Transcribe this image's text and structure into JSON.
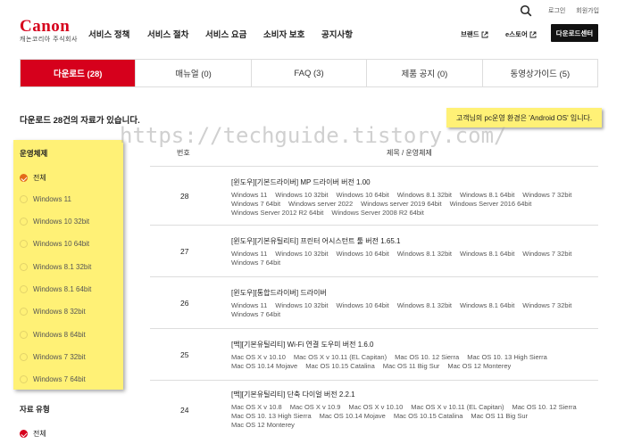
{
  "header": {
    "logo": "Canon",
    "logo_sub": "캐논코리아 주식회사",
    "nav": [
      "서비스 정책",
      "서비스 절차",
      "서비스 요금",
      "소비자 보호",
      "공지사항"
    ],
    "top_links": [
      "로그인",
      "회원가입"
    ],
    "brand_links": [
      "브랜드",
      "e스토어"
    ],
    "center_button": "다운로드센터"
  },
  "tabs": [
    {
      "label": "다운로드 (28)",
      "active": true
    },
    {
      "label": "매뉴얼 (0)",
      "active": false
    },
    {
      "label": "FAQ (3)",
      "active": false
    },
    {
      "label": "제품 공지 (0)",
      "active": false
    },
    {
      "label": "동영상가이드 (5)",
      "active": false
    }
  ],
  "result": {
    "prefix": "다운로드 ",
    "count": "28",
    "suffix": "건의 자료가 있습니다.",
    "os_notice": "고객님의 pc운영 환경은 'Android OS' 입니다."
  },
  "watermark": "https://techguide.tistory.com/",
  "filters": {
    "os_title": "운영체제",
    "os_items": [
      {
        "label": "전체",
        "checked": true
      },
      {
        "label": "Windows 11",
        "checked": false
      },
      {
        "label": "Windows 10 32bit",
        "checked": false
      },
      {
        "label": "Windows 10 64bit",
        "checked": false
      },
      {
        "label": "Windows 8.1 32bit",
        "checked": false
      },
      {
        "label": "Windows 8.1 64bit",
        "checked": false
      },
      {
        "label": "Windows 8 32bit",
        "checked": false
      },
      {
        "label": "Windows 8 64bit",
        "checked": false
      },
      {
        "label": "Windows 7 32bit",
        "checked": false
      },
      {
        "label": "Windows 7 64bit",
        "checked": false
      }
    ],
    "type_title": "자료 유형",
    "type_items": [
      {
        "label": "전체",
        "checked": true
      }
    ]
  },
  "table": {
    "headers": [
      "번호",
      "제목 / 운영체제"
    ],
    "rows": [
      {
        "num": "28",
        "title": "[윈도우][기본드라이버] MP 드라이버 버전 1.00",
        "os": [
          "Windows 11",
          "Windows 10 32bit",
          "Windows 10 64bit",
          "Windows 8.1 32bit",
          "Windows 8.1 64bit",
          "Windows 7 32bit",
          "Windows 7 64bit",
          "Windows server 2022",
          "Windows server 2019 64bit",
          "Windows Server 2016 64bit",
          "Windows Server 2012 R2 64bit",
          "Windows Server 2008 R2 64bit"
        ]
      },
      {
        "num": "27",
        "title": "[윈도우][기본유틸리티] 프린터 어시스턴트 툴 버전 1.65.1",
        "os": [
          "Windows 11",
          "Windows 10 32bit",
          "Windows 10 64bit",
          "Windows 8.1 32bit",
          "Windows 8.1 64bit",
          "Windows 7 32bit",
          "Windows 7 64bit"
        ]
      },
      {
        "num": "26",
        "title": "[윈도우][통합드라이버] 드라이버",
        "os": [
          "Windows 11",
          "Windows 10 32bit",
          "Windows 10 64bit",
          "Windows 8.1 32bit",
          "Windows 8.1 64bit",
          "Windows 7 32bit",
          "Windows 7 64bit"
        ]
      },
      {
        "num": "25",
        "title": "[맥][기본유틸리티] Wi-Fi 연결 도우미 버전 1.6.0",
        "os": [
          "Mac OS X v 10.10",
          "Mac OS X v 10.11 (EL Capitan)",
          "Mac OS 10. 12 Sierra",
          "Mac OS 10. 13 High Sierra",
          "Mac OS 10.14 Mojave",
          "Mac OS 10.15 Catalina",
          "Mac OS 11 Big Sur",
          "Mac OS 12 Monterey"
        ]
      },
      {
        "num": "24",
        "title": "[맥][기본유틸리티] 단축 다이얼 버전 2.2.1",
        "os": [
          "Mac OS X v 10.8",
          "Mac OS X v 10.9",
          "Mac OS X v 10.10",
          "Mac OS X v 10.11 (EL Capitan)",
          "Mac OS 10. 12 Sierra",
          "Mac OS 10. 13 High Sierra",
          "Mac OS 10.14 Mojave",
          "Mac OS 10.15 Catalina",
          "Mac OS 11 Big Sur",
          "Mac OS 12 Monterey"
        ]
      }
    ]
  },
  "colors": {
    "brand": "#d6001c",
    "highlight": "#fff176",
    "check": "#e36a1a"
  }
}
